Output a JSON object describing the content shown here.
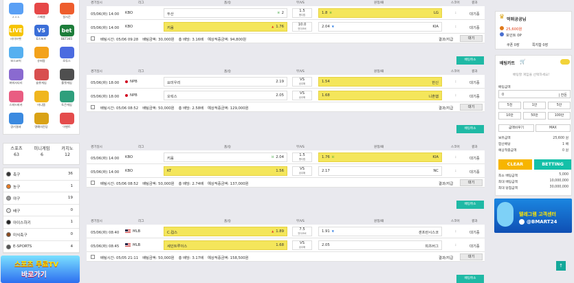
{
  "left": {
    "icons": [
      {
        "label": "ㅅㅅㅅ",
        "color": "#5aa0f5",
        "icon": "sports-icon"
      },
      {
        "label": "스페셜",
        "color": "#e64848",
        "icon": "special-icon"
      },
      {
        "label": "실시간",
        "color": "#ee5d2d",
        "icon": "live-icon"
      },
      {
        "label": "라이브벳",
        "color": "#f6c400",
        "icon": "live-bet-icon",
        "text": "LIVE"
      },
      {
        "label": "E스포츠",
        "color": "#3b6fd8",
        "icon": "esports-icon",
        "text": "VS"
      },
      {
        "label": "BET365",
        "color": "#1d7d3a",
        "icon": "bet365-icon",
        "text": "bet"
      },
      {
        "label": "보스코어",
        "color": "#56b0f0",
        "icon": "bosscore-icon"
      },
      {
        "label": "슈퍼팡",
        "color": "#f3a21b",
        "icon": "superpang-icon"
      },
      {
        "label": "로투스",
        "color": "#4b6be0",
        "icon": "lotus-icon"
      },
      {
        "label": "파워사다리",
        "color": "#8a6ad0",
        "icon": "ladder-icon"
      },
      {
        "label": "슬롯게임",
        "color": "#d84f4f",
        "icon": "slot-icon"
      },
      {
        "label": "룰렛게임",
        "color": "#4f4f4f",
        "icon": "roulette-icon"
      },
      {
        "label": "스피드바카",
        "color": "#e95d82",
        "icon": "baccarat-icon"
      },
      {
        "label": "미니맵",
        "color": "#f0b61e",
        "icon": "minimap-icon"
      },
      {
        "label": "토큰게임",
        "color": "#2f9f7c",
        "icon": "token-icon"
      },
      {
        "label": "경기결과",
        "color": "#3b8ae0",
        "icon": "search-icon"
      },
      {
        "label": "명예의전당",
        "color": "#d9a216",
        "icon": "trophy-icon"
      },
      {
        "label": "이벤트",
        "color": "#e44c4c",
        "icon": "gift-icon"
      }
    ],
    "counts": [
      {
        "label": "스포츠",
        "value": "63"
      },
      {
        "label": "미니게임",
        "value": "6"
      },
      {
        "label": "카지노",
        "value": "12"
      }
    ],
    "sports": [
      {
        "name": "축구",
        "count": "36",
        "color": "#333"
      },
      {
        "name": "농구",
        "count": "1",
        "color": "#e87b24"
      },
      {
        "name": "야구",
        "count": "19",
        "color": "#999"
      },
      {
        "name": "배구",
        "count": "0",
        "color": "#e7e7e7"
      },
      {
        "name": "아이스하키",
        "count": "1",
        "color": "#222"
      },
      {
        "name": "미식축구",
        "count": "0",
        "color": "#8b4a1f"
      },
      {
        "name": "E-SPORTS",
        "count": "4",
        "color": "#555"
      }
    ],
    "banner": {
      "line1": "스포츠 무료TV",
      "line2": "바로가기"
    }
  },
  "header": {
    "time": "경기일시",
    "league": "리그",
    "home": "홈/승",
    "draw": "무/VS",
    "away": "원정/패",
    "score": "스코어",
    "result": "결과"
  },
  "blocks": [
    {
      "rows": [
        {
          "time": "05/06(화) 14:00",
          "league": "KBO",
          "flag": "",
          "home": "두산",
          "home_odds": "2",
          "home_mark": "H",
          "home_hl": false,
          "draw": "1.5",
          "draw_sub": "핸디캡",
          "away": "LG",
          "away_odds": "1.8",
          "away_mark": "H",
          "away_hl": true,
          "score": ":",
          "status": "대기중"
        },
        {
          "time": "05/06(화) 14:00",
          "league": "KBO",
          "flag": "",
          "home": "키움",
          "home_odds": "1.76",
          "home_mark": "▲",
          "home_hl": true,
          "draw": "10.0",
          "draw_sub": "언더오버",
          "away": "KIA",
          "away_odds": "2.04",
          "away_mark": "▼",
          "away_hl": false,
          "score": ":",
          "status": "대기중"
        }
      ],
      "summary": {
        "time": "배팅시간: 05/06 09:28",
        "amount": "배팅금액: 30,000원",
        "odds": "총 배당: 3.16배",
        "win": "예상적중금액: 94,800원",
        "result": "결과/지급",
        "delete": "대기"
      }
    },
    {
      "rows": [
        {
          "time": "05/06(화) 18:00",
          "league": "NPB",
          "flag": "jp",
          "home": "요미우리",
          "home_odds": "2.19",
          "home_mark": "",
          "home_hl": false,
          "draw": "VS",
          "draw_sub": "승무패",
          "away": "한신",
          "away_odds": "1.54",
          "away_mark": "",
          "away_hl": true,
          "score": ":",
          "status": "대기중"
        },
        {
          "time": "05/06(화) 18:00",
          "league": "NPB",
          "flag": "jp",
          "home": "오릭스",
          "home_odds": "2.05",
          "home_mark": "",
          "home_hl": false,
          "draw": "VS",
          "draw_sub": "승무패",
          "away": "니혼햄",
          "away_odds": "1.68",
          "away_mark": "",
          "away_hl": true,
          "score": ":",
          "status": "대기중"
        }
      ],
      "summary": {
        "time": "배팅시간: 05/06 08:52",
        "amount": "배팅금액: 50,000원",
        "odds": "총 배당: 2.58배",
        "win": "예상적중금액: 129,000원",
        "result": "결과/지급",
        "delete": "대기"
      }
    },
    {
      "rows": [
        {
          "time": "05/06(화) 14:00",
          "league": "KBO",
          "flag": "",
          "home": "키움",
          "home_odds": "2.04",
          "home_mark": "H",
          "home_hl": false,
          "draw": "1.5",
          "draw_sub": "핸디캡",
          "away": "KIA",
          "away_odds": "1.76",
          "away_mark": "H",
          "away_hl": true,
          "score": ":",
          "status": "대기중"
        },
        {
          "time": "05/06(화) 14:00",
          "league": "KBO",
          "flag": "",
          "home": "KT",
          "home_odds": "1.56",
          "home_mark": "",
          "home_hl": true,
          "draw": "VS",
          "draw_sub": "승무패",
          "away": "NC",
          "away_odds": "2.17",
          "away_mark": "",
          "away_hl": false,
          "score": ":",
          "status": "대기중"
        }
      ],
      "summary": {
        "time": "배팅시간: 05/06 08:52",
        "amount": "배팅금액: 50,000원",
        "odds": "총 배당: 2.74배",
        "win": "예상적중금액: 137,000원",
        "result": "결과/지급",
        "delete": "대기"
      }
    },
    {
      "rows": [
        {
          "time": "05/06(화) 08:40",
          "league": "MLB",
          "flag": "us",
          "home": "C.컵스",
          "home_odds": "1.89",
          "home_mark": "▲",
          "home_hl": true,
          "draw": "7.5",
          "draw_sub": "언더오버",
          "away": "샌프란시스코",
          "away_odds": "1.91",
          "away_mark": "▼",
          "away_hl": false,
          "score": ":",
          "status": "대기중"
        },
        {
          "time": "05/06(화) 08:45",
          "league": "MLB",
          "flag": "us",
          "home": "세인트루이스",
          "home_odds": "1.68",
          "home_mark": "",
          "home_hl": true,
          "draw": "VS",
          "draw_sub": "승무패",
          "away": "피츠버그",
          "away_odds": "2.05",
          "away_mark": "",
          "away_hl": false,
          "score": ":",
          "status": "대기중"
        }
      ],
      "summary": {
        "time": "배팅시간: 05/05 21:11",
        "amount": "배팅금액: 50,000원",
        "odds": "총 배당: 3.17배",
        "win": "예상적중금액: 158,500원",
        "result": "결과/지급",
        "delete": "대기"
      }
    }
  ],
  "cancel_label": "배팅취소",
  "user": {
    "name": "먹튀공공님",
    "money": "25,600원",
    "point": "포인트 0P",
    "coupon": "쿠폰 0장",
    "message": "쪽지함 0장"
  },
  "cart": {
    "title": "배팅카트",
    "empty": "배팅할 게임을 선택하세요!",
    "amount_label": "배팅금액",
    "amount_value": "0",
    "all_in": "| 잔돈",
    "quick": [
      "5천",
      "1만",
      "5만",
      "10만",
      "50만",
      "100만"
    ],
    "reset": "금액비우기",
    "max": "MAX",
    "info": [
      {
        "k": "보유금액",
        "v": "25,600 원"
      },
      {
        "k": "합산배당",
        "v": "1 배"
      },
      {
        "k": "예상적중금액",
        "v": "0 원"
      }
    ],
    "clear": "CLEAR",
    "betting": "BETTING",
    "limits": [
      {
        "k": "최소 배팅금액",
        "v": "5,000"
      },
      {
        "k": "최대 배팅금액",
        "v": "10,000,000"
      },
      {
        "k": "최대 당첨금액",
        "v": "30,000,000"
      }
    ]
  },
  "banner_right": {
    "line1": "텔레그램 고객센터",
    "line2": "@BMART24"
  },
  "totop": "↑"
}
